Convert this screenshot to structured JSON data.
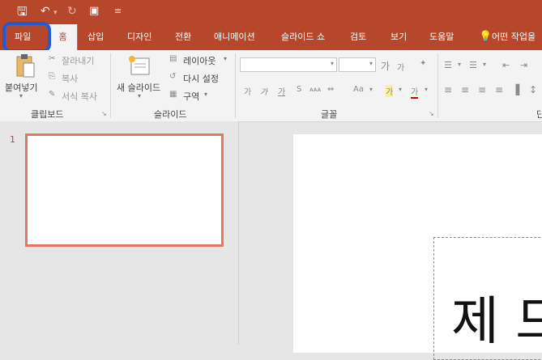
{
  "quick_access": {
    "save_icon": "save-icon",
    "undo_icon": "undo-icon",
    "redo_icon": "redo-icon",
    "present_icon": "present-icon",
    "customize_icon": "customize-icon"
  },
  "tabs": [
    {
      "label": "파일"
    },
    {
      "label": "홈"
    },
    {
      "label": "삽입"
    },
    {
      "label": "디자인"
    },
    {
      "label": "전환"
    },
    {
      "label": "애니메이션"
    },
    {
      "label": "슬라이드 쇼"
    },
    {
      "label": "검토"
    },
    {
      "label": "보기"
    },
    {
      "label": "도움말"
    },
    {
      "label": "어떤 작업을"
    }
  ],
  "ribbon": {
    "clipboard": {
      "paste": "붙여넣기",
      "cut": "잘라내기",
      "copy": "복사",
      "format_painter": "서식 복사",
      "group": "클립보드"
    },
    "slides": {
      "new_slide": "새 슬라이드",
      "layout": "레이아웃",
      "reset": "다시 설정",
      "section": "구역",
      "group": "슬라이드"
    },
    "font": {
      "group": "글꼴",
      "font_name": "",
      "font_size": "",
      "grow": "가",
      "shrink": "가",
      "bold": "가",
      "italic": "가",
      "underline": "가",
      "strike": "S",
      "spacing": "ᴀᴀᴀ",
      "case": "Aa",
      "highlight": "가",
      "color": "가"
    },
    "paragraph_group_partial": "단"
  },
  "slides_pane": {
    "slide_number": "1"
  },
  "canvas": {
    "title_text": "제 드"
  }
}
